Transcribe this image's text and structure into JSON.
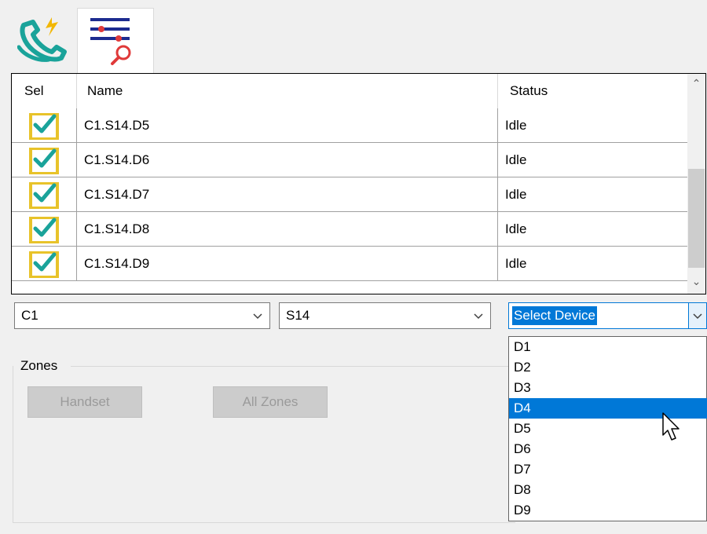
{
  "tabs": [
    {
      "icon": "phone-call-icon"
    },
    {
      "icon": "filter-search-icon",
      "active": true
    }
  ],
  "grid": {
    "columns": [
      "Sel",
      "Name",
      "Status"
    ],
    "rows": [
      {
        "name": "C1.S14.D5",
        "status": "Idle",
        "selected": true
      },
      {
        "name": "C1.S14.D6",
        "status": "Idle",
        "selected": true
      },
      {
        "name": "C1.S14.D7",
        "status": "Idle",
        "selected": true
      },
      {
        "name": "C1.S14.D8",
        "status": "Idle",
        "selected": true
      },
      {
        "name": "C1.S14.D9",
        "status": "Idle",
        "selected": true
      }
    ]
  },
  "filters": {
    "controller": "C1",
    "segment": "S14",
    "device": "Select Device"
  },
  "zones": {
    "label": "Zones",
    "handset_label": "Handset",
    "all_zones_label": "All Zones"
  },
  "device_options": [
    "D1",
    "D2",
    "D3",
    "D4",
    "D5",
    "D6",
    "D7",
    "D8",
    "D9"
  ],
  "device_highlighted": "D4",
  "colors": {
    "accent": "#0078d7",
    "check": "#1aa39a",
    "checkbox": "#e8c32a"
  }
}
